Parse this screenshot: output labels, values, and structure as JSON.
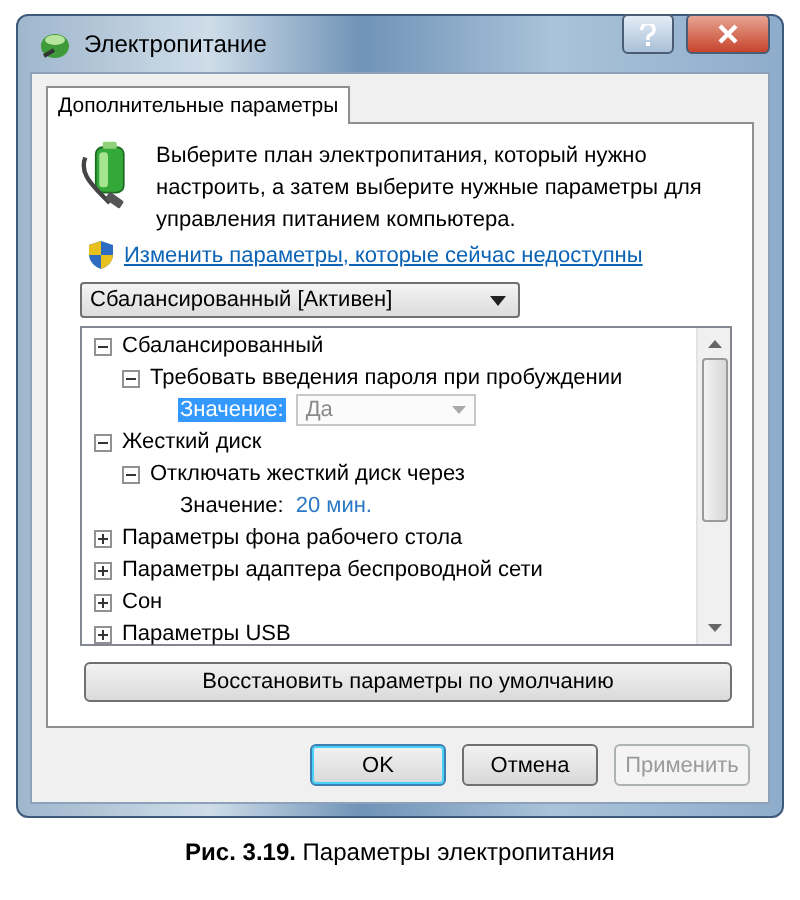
{
  "window": {
    "title": "Электропитание"
  },
  "tabs": [
    {
      "label": "Дополнительные параметры",
      "selected": true
    }
  ],
  "description": "Выберите план электропитания, который нужно настроить, а затем выберите нужные параметры для управления питанием компьютера.",
  "admin_link": "Изменить параметры, которые сейчас недоступны",
  "plan_select": {
    "value": "Сбалансированный [Активен]"
  },
  "tree": [
    {
      "label": "Сбалансированный",
      "expanded": true,
      "children": [
        {
          "label": "Требовать введения пароля при пробуждении",
          "expanded": true,
          "children": [
            {
              "kind": "dropdown",
              "label": "Значение:",
              "value": "Да",
              "selected": true,
              "disabled": true
            }
          ]
        }
      ]
    },
    {
      "label": "Жесткий диск",
      "expanded": true,
      "children": [
        {
          "label": "Отключать жесткий диск через",
          "expanded": true,
          "children": [
            {
              "kind": "text",
              "label": "Значение:",
              "value": "20 мин.",
              "selected": false,
              "disabled": false
            }
          ]
        }
      ]
    },
    {
      "label": "Параметры фона рабочего стола",
      "expanded": false
    },
    {
      "label": "Параметры адаптера беспроводной сети",
      "expanded": false
    },
    {
      "label": "Сон",
      "expanded": false
    },
    {
      "label": "Параметры USB",
      "expanded": false
    }
  ],
  "restore_button": "Восстановить параметры по умолчанию",
  "buttons": [
    {
      "label": "OK",
      "default": true,
      "disabled": false
    },
    {
      "label": "Отмена",
      "default": false,
      "disabled": false
    },
    {
      "label": "Применить",
      "default": false,
      "disabled": true
    }
  ],
  "caption": "**Рис. 3.19.** Параметры электропитания"
}
